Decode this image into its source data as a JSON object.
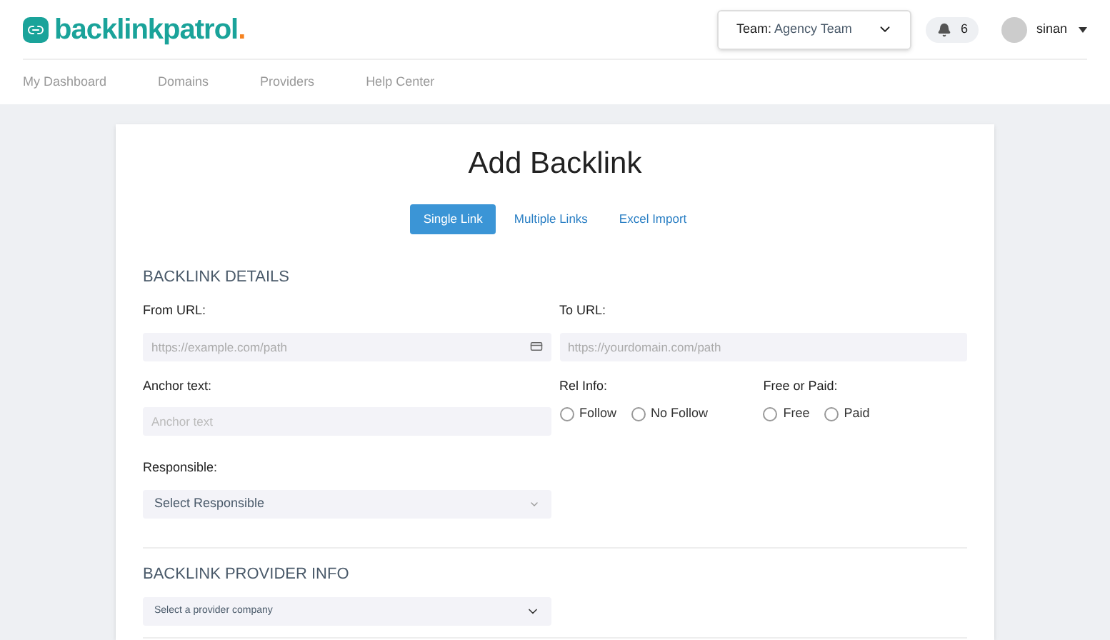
{
  "logo": {
    "name": "backlinkpatrol",
    "dot": "."
  },
  "team": {
    "label": "Team:",
    "value": "Agency Team"
  },
  "notifications": {
    "count": "6"
  },
  "user": {
    "name": "sinan"
  },
  "nav": [
    {
      "label": "My Dashboard"
    },
    {
      "label": "Domains"
    },
    {
      "label": "Providers"
    },
    {
      "label": "Help Center"
    }
  ],
  "title": "Add Backlink",
  "tabs": [
    {
      "label": "Single Link",
      "selected": true
    },
    {
      "label": "Multiple Links",
      "selected": false
    },
    {
      "label": "Excel Import",
      "selected": false
    }
  ],
  "details": {
    "heading": "BACKLINK DETAILS",
    "from_url": {
      "label": "From URL:",
      "placeholder": "https://example.com/path"
    },
    "to_url": {
      "label": "To URL:",
      "placeholder": "https://yourdomain.com/path"
    },
    "anchor": {
      "label": "Anchor text:",
      "placeholder": "Anchor text"
    },
    "rel": {
      "label": "Rel Info:",
      "options": [
        {
          "label": "Follow",
          "selected": false
        },
        {
          "label": "No Follow",
          "selected": false
        }
      ]
    },
    "pay": {
      "label": "Free or Paid:",
      "options": [
        {
          "label": "Free",
          "selected": false
        },
        {
          "label": "Paid",
          "selected": false
        }
      ]
    },
    "responsible": {
      "label": "Responsible:",
      "value": "Select Responsible"
    }
  },
  "provider": {
    "heading": "BACKLINK PROVIDER INFO",
    "value": "Select a provider company"
  }
}
